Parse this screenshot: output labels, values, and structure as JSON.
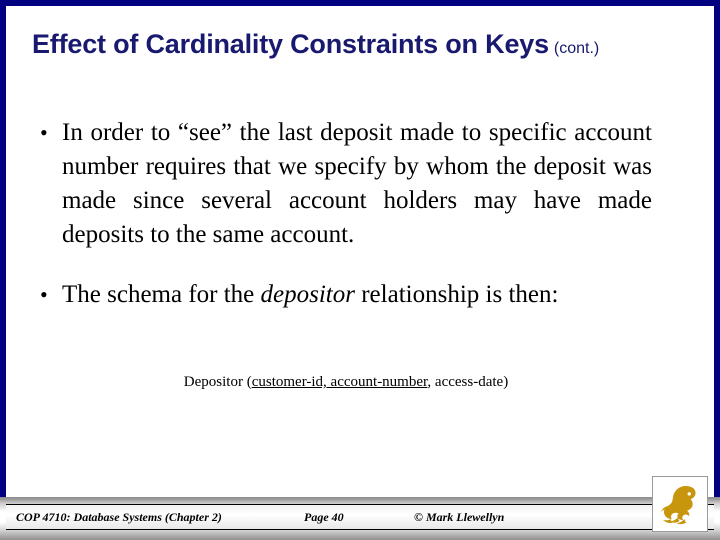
{
  "slide": {
    "title": "Effect of Cardinality Constraints on Keys",
    "title_suffix": "(cont.)",
    "bullets": [
      {
        "marker": "•",
        "text_plain": "In order to “see” the last deposit made to specific account number requires that we specify by whom the deposit was made since several account holders may have made deposits to the same account."
      },
      {
        "marker": "•",
        "text_before_italic": "The schema for the ",
        "italic_word": "depositor",
        "text_after_italic": " relationship is then:"
      }
    ],
    "schema": {
      "relation_name": "Depositor",
      "open_paren": "(",
      "key_attributes": "customer-id, account-number",
      "separator": ", ",
      "other_attributes": "access-date",
      "close_paren": ")"
    }
  },
  "footer": {
    "course": "COP 4710: Database Systems  (Chapter 2)",
    "page": "Page 40",
    "author": "© Mark Llewellyn"
  },
  "logo": {
    "name": "ucf-pegasus-logo",
    "color": "#C8960C"
  },
  "colors": {
    "title": "#191970",
    "frame": "#000080",
    "body_text": "#000000",
    "background": "#FFFFFF",
    "logo_gold": "#C8960C"
  }
}
